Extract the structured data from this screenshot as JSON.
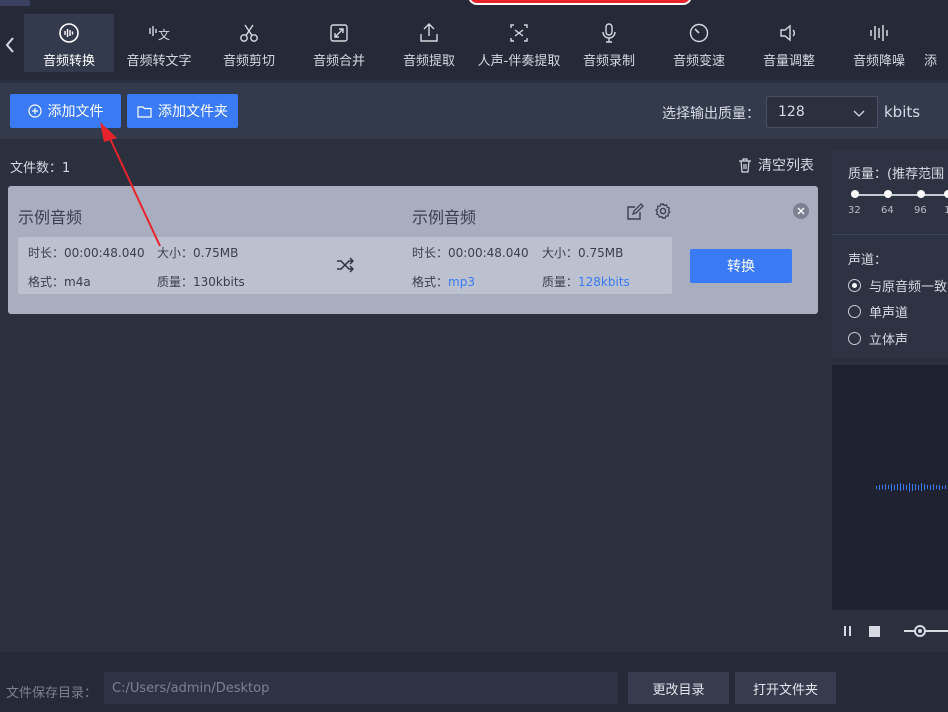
{
  "nav": {
    "items": [
      {
        "label": "音频转换",
        "icon": "audio-convert-icon",
        "active": true
      },
      {
        "label": "音频转文字",
        "icon": "speech-to-text-icon"
      },
      {
        "label": "音频剪切",
        "icon": "scissors-icon"
      },
      {
        "label": "音频合并",
        "icon": "merge-icon"
      },
      {
        "label": "音频提取",
        "icon": "extract-icon"
      },
      {
        "label": "人声-伴奏提取",
        "icon": "vocal-separate-icon"
      },
      {
        "label": "音频录制",
        "icon": "microphone-icon"
      },
      {
        "label": "音频变速",
        "icon": "speed-icon"
      },
      {
        "label": "音量调整",
        "icon": "volume-icon"
      },
      {
        "label": "音频降噪",
        "icon": "denoise-icon"
      },
      {
        "label": "添",
        "icon": "more-icon"
      }
    ]
  },
  "toolbar": {
    "add_file_label": "添加文件",
    "add_folder_label": "添加文件夹",
    "quality_label": "选择输出质量：",
    "quality_value": "128",
    "quality_unit": "kbits"
  },
  "filelist": {
    "count_label": "文件数：1",
    "clear_label": "清空列表"
  },
  "file": {
    "source": {
      "name": "示例音频",
      "duration": "时长：00:00:48.040",
      "size": "大小：0.75MB",
      "format_label": "格式：",
      "format": "m4a",
      "quality_label": "质量：",
      "quality": "130kbits"
    },
    "target": {
      "name": "示例音频",
      "duration": "时长：00:00:48.040",
      "size": "大小：0.75MB",
      "format_label": "格式：",
      "format": "mp3",
      "quality_label": "质量：",
      "quality": "128kbits"
    },
    "convert_label": "转换"
  },
  "settings": {
    "quality_title": "质量：(推荐范围",
    "slider_ticks": [
      "32",
      "64",
      "96",
      "1"
    ],
    "channel_title": "声道：",
    "channel_options": [
      "与原音频一致",
      "单声道",
      "立体声"
    ],
    "channel_selected": 0
  },
  "footer": {
    "save_dir_label": "文件保存目录：",
    "save_dir_value": "C:/Users/admin/Desktop",
    "change_dir_label": "更改目录",
    "open_folder_label": "打开文件夹"
  },
  "colors": {
    "accent": "#3a7bf5",
    "annotation_arrow": "#e8232b",
    "background": "#2b2f3e"
  }
}
